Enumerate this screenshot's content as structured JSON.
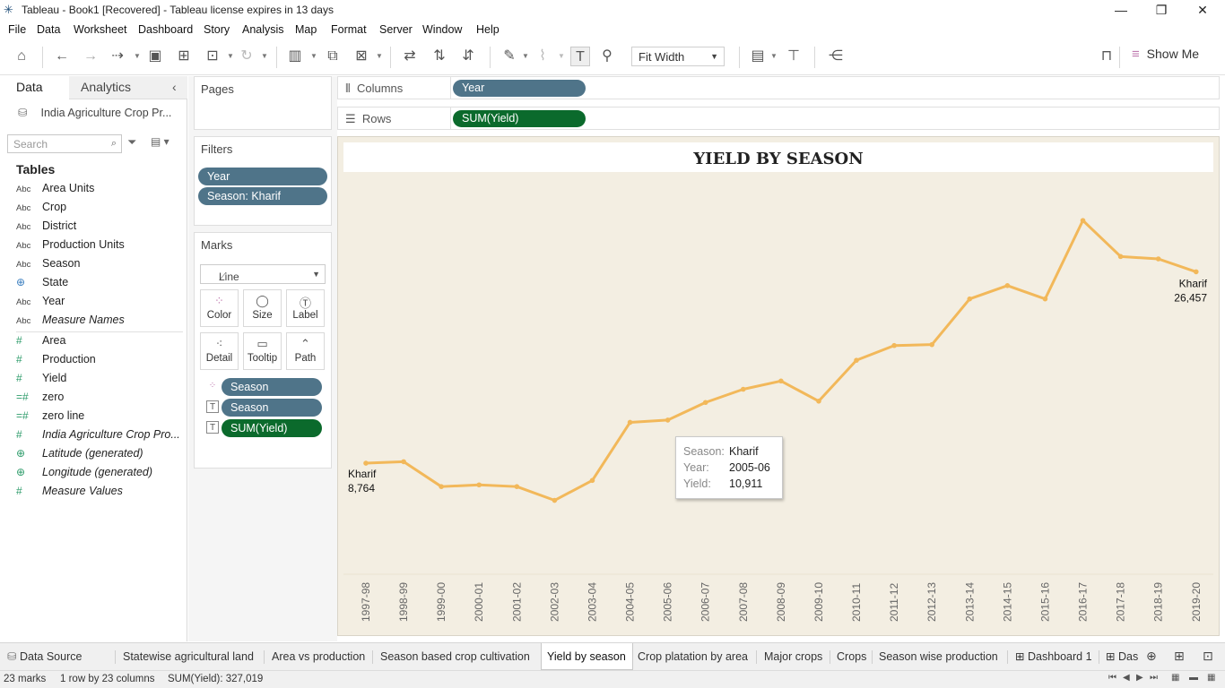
{
  "window": {
    "title": "Tableau - Book1 [Recovered] - Tableau license expires in 13 days",
    "minimize": "—",
    "restore": "❐",
    "close": "✕"
  },
  "menu": [
    "File",
    "Data",
    "Worksheet",
    "Dashboard",
    "Story",
    "Analysis",
    "Map",
    "Format",
    "Server",
    "Window",
    "Help"
  ],
  "toolbar": {
    "fit": "Fit Width",
    "show_me": "Show Me"
  },
  "data_pane": {
    "tab_data": "Data",
    "tab_analytics": "Analytics",
    "datasource": "India Agriculture Crop Pr...",
    "search_placeholder": "Search",
    "tables_heading": "Tables",
    "dimensions": [
      {
        "type": "Abc",
        "name": "Area Units"
      },
      {
        "type": "Abc",
        "name": "Crop"
      },
      {
        "type": "Abc",
        "name": "District"
      },
      {
        "type": "Abc",
        "name": "Production Units"
      },
      {
        "type": "Abc",
        "name": "Season"
      },
      {
        "type": "globe",
        "name": "State"
      },
      {
        "type": "Abc",
        "name": "Year"
      },
      {
        "type": "Abc",
        "name": "Measure Names"
      }
    ],
    "measures": [
      {
        "type": "#",
        "name": "Area"
      },
      {
        "type": "#",
        "name": "Production"
      },
      {
        "type": "#",
        "name": "Yield"
      },
      {
        "type": "=#",
        "name": "zero"
      },
      {
        "type": "=#",
        "name": "zero line"
      },
      {
        "type": "#",
        "name": "India Agriculture Crop Pro..."
      },
      {
        "type": "globe",
        "name": "Latitude (generated)"
      },
      {
        "type": "globe",
        "name": "Longitude (generated)"
      },
      {
        "type": "#",
        "name": "Measure Values"
      }
    ]
  },
  "cards": {
    "pages": "Pages",
    "filters": "Filters",
    "filter_pills": [
      "Year",
      "Season: Kharif"
    ],
    "marks": "Marks",
    "mark_type": "Line",
    "mark_buttons": [
      "Color",
      "Size",
      "Label",
      "Detail",
      "Tooltip",
      "Path"
    ],
    "mark_pills": [
      "Season",
      "Season",
      "SUM(Yield)"
    ]
  },
  "shelves": {
    "columns_label": "Columns",
    "columns_pill": "Year",
    "rows_label": "Rows",
    "rows_pill": "SUM(Yield)"
  },
  "viz": {
    "title": "YIELD BY SEASON",
    "start_label": [
      "Kharif",
      "8,764"
    ],
    "end_label": [
      "Kharif",
      "26,457"
    ],
    "line_color": "#f2b85a",
    "background": "#f3eee2"
  },
  "chart_data": {
    "type": "line",
    "title": "YIELD BY SEASON",
    "categories": [
      "1997-98",
      "1998-99",
      "1999-00",
      "2000-01",
      "2001-02",
      "2002-03",
      "2003-04",
      "2004-05",
      "2005-06",
      "2006-07",
      "2007-08",
      "2008-09",
      "2009-10",
      "2010-11",
      "2011-12",
      "2012-13",
      "2013-14",
      "2014-15",
      "2015-16",
      "2016-17",
      "2017-18",
      "2018-19",
      "2019-20"
    ],
    "series": [
      {
        "name": "Kharif",
        "values": [
          8764,
          8900,
          6600,
          6760,
          6600,
          5330,
          7170,
          12540,
          12750,
          14380,
          15600,
          16360,
          14500,
          18280,
          19640,
          19730,
          23950,
          25180,
          23950,
          31200,
          27870,
          27650,
          26457
        ]
      }
    ],
    "ylim": [
      -1500,
      35600
    ],
    "grid": false,
    "axis_visible": false
  },
  "tooltip": {
    "season_key": "Season:",
    "season_val": "Kharif",
    "year_key": "Year:",
    "year_val": "2005-06",
    "yield_key": "Yield:",
    "yield_val": "10,911"
  },
  "sheet_tabs": {
    "data_source": "Data Source",
    "tabs": [
      "Statewise agricultural land",
      "Area vs production",
      "Season based crop cultivation",
      "Yield by season",
      "Crop platation by area",
      "Major crops",
      "Crops",
      "Season wise production",
      "Dashboard 1",
      "Das"
    ],
    "active": "Yield by season"
  },
  "status": {
    "marks": "23 marks",
    "rows_cols": "1 row by 23 columns",
    "sum": "SUM(Yield): 327,019"
  }
}
